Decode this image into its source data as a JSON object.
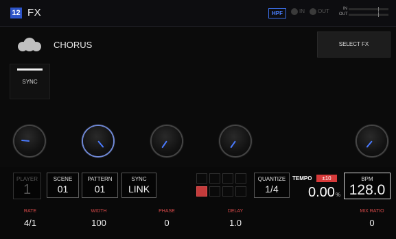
{
  "header": {
    "channel": "12",
    "title": "FX",
    "hpf": "HPF",
    "in": "IN",
    "out": "OUT",
    "meter_in": "IN",
    "meter_out": "OUT"
  },
  "effect": {
    "name": "CHORUS",
    "icon": "cloud-icon",
    "select_label": "SELECT FX",
    "sync_label": "SYNC"
  },
  "knobs": [
    {
      "name": "rate",
      "value_fraction": 0.0
    },
    {
      "name": "width",
      "value_fraction": 0.75,
      "active": true
    },
    {
      "name": "phase",
      "value_fraction": 0.25
    },
    {
      "name": "delay",
      "value_fraction": 0.25
    },
    {
      "name": "mix-ratio",
      "value_fraction": 0.2
    }
  ],
  "controls": {
    "player": {
      "label": "PLAYER",
      "value": "1"
    },
    "scene": {
      "label": "SCENE",
      "value": "01"
    },
    "pattern": {
      "label": "PATTERN",
      "value": "01"
    },
    "sync": {
      "label": "SYNC",
      "value": "LINK"
    },
    "quantize": {
      "label": "QUANTIZE",
      "value": "1/4"
    },
    "tempo": {
      "label": "TEMPO",
      "diff": "±10",
      "value": "0.00",
      "unit": "%"
    },
    "bpm": {
      "label": "BPM",
      "value": "128.0"
    },
    "step_grid": {
      "active_step": 5
    }
  },
  "params": [
    {
      "label": "RATE",
      "value": "4/1"
    },
    {
      "label": "WIDTH",
      "value": "100"
    },
    {
      "label": "PHASE",
      "value": "0"
    },
    {
      "label": "DELAY",
      "value": "1.0"
    },
    {
      "label": "MIX RATIO",
      "value": "0"
    }
  ],
  "colors": {
    "accent_blue": "#4a7aff",
    "channel_badge": "#2d54c8",
    "alert_red": "#d63a3a",
    "param_label": "#d94a4a"
  }
}
